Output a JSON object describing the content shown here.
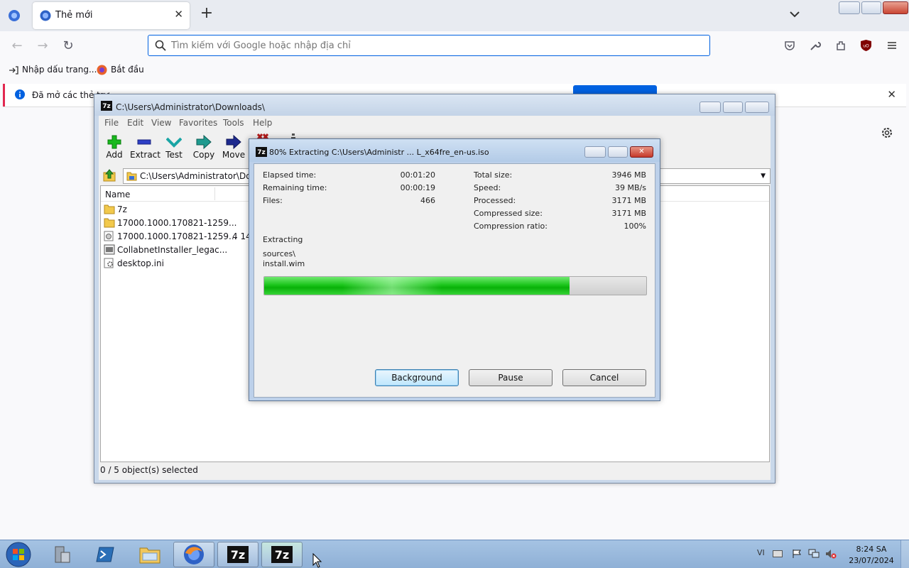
{
  "browser": {
    "tab_title": "Thẻ mới",
    "url_placeholder": "Tìm kiếm với Google hoặc nhập địa chỉ",
    "bookmarks": [
      "Nhập dấu trang...",
      "Bắt đầu"
    ],
    "notification_text": "Đã mở các thẻ trư"
  },
  "zip_main": {
    "title": "C:\\Users\\Administrator\\Downloads\\",
    "menu": [
      "File",
      "Edit",
      "View",
      "Favorites",
      "Tools",
      "Help"
    ],
    "toolbar": [
      "Add",
      "Extract",
      "Test",
      "Copy",
      "Move"
    ],
    "path": "C:\\Users\\Administrator\\Dowr",
    "column_name": "Name",
    "files": [
      {
        "name": "7z",
        "size": "",
        "icon": "folder-icon"
      },
      {
        "name": "17000.1000.170821-1259...",
        "size": "",
        "icon": "folder-icon"
      },
      {
        "name": "17000.1000.170821-1259...",
        "size": "4 14:",
        "icon": "disc-image-icon"
      },
      {
        "name": "CollabnetInstaller_legac...",
        "size": "",
        "icon": "installer-icon"
      },
      {
        "name": "desktop.ini",
        "size": "",
        "icon": "settings-file-icon"
      }
    ],
    "status": "0 / 5 object(s) selected"
  },
  "progress_dialog": {
    "title": "80% Extracting C:\\Users\\Administr ... L_x64fre_en-us.iso",
    "left_stats": [
      {
        "label": "Elapsed time:",
        "value": "00:01:20"
      },
      {
        "label": "Remaining time:",
        "value": "00:00:19"
      },
      {
        "label": "Files:",
        "value": "466"
      }
    ],
    "right_stats": [
      {
        "label": "Total size:",
        "value": "3946 MB"
      },
      {
        "label": "Speed:",
        "value": "39 MB/s"
      },
      {
        "label": "Processed:",
        "value": "3171 MB"
      },
      {
        "label": "Compressed size:",
        "value": "3171 MB"
      },
      {
        "label": "Compression ratio:",
        "value": "100%"
      }
    ],
    "operation": "Extracting",
    "current_folder": "sources\\",
    "current_file": "install.wim",
    "progress_percent": 80,
    "buttons": {
      "background": "Background",
      "pause": "Pause",
      "cancel": "Cancel"
    }
  },
  "taskbar": {
    "language": "VI",
    "time": "8:24 SA",
    "date": "23/07/2024"
  }
}
